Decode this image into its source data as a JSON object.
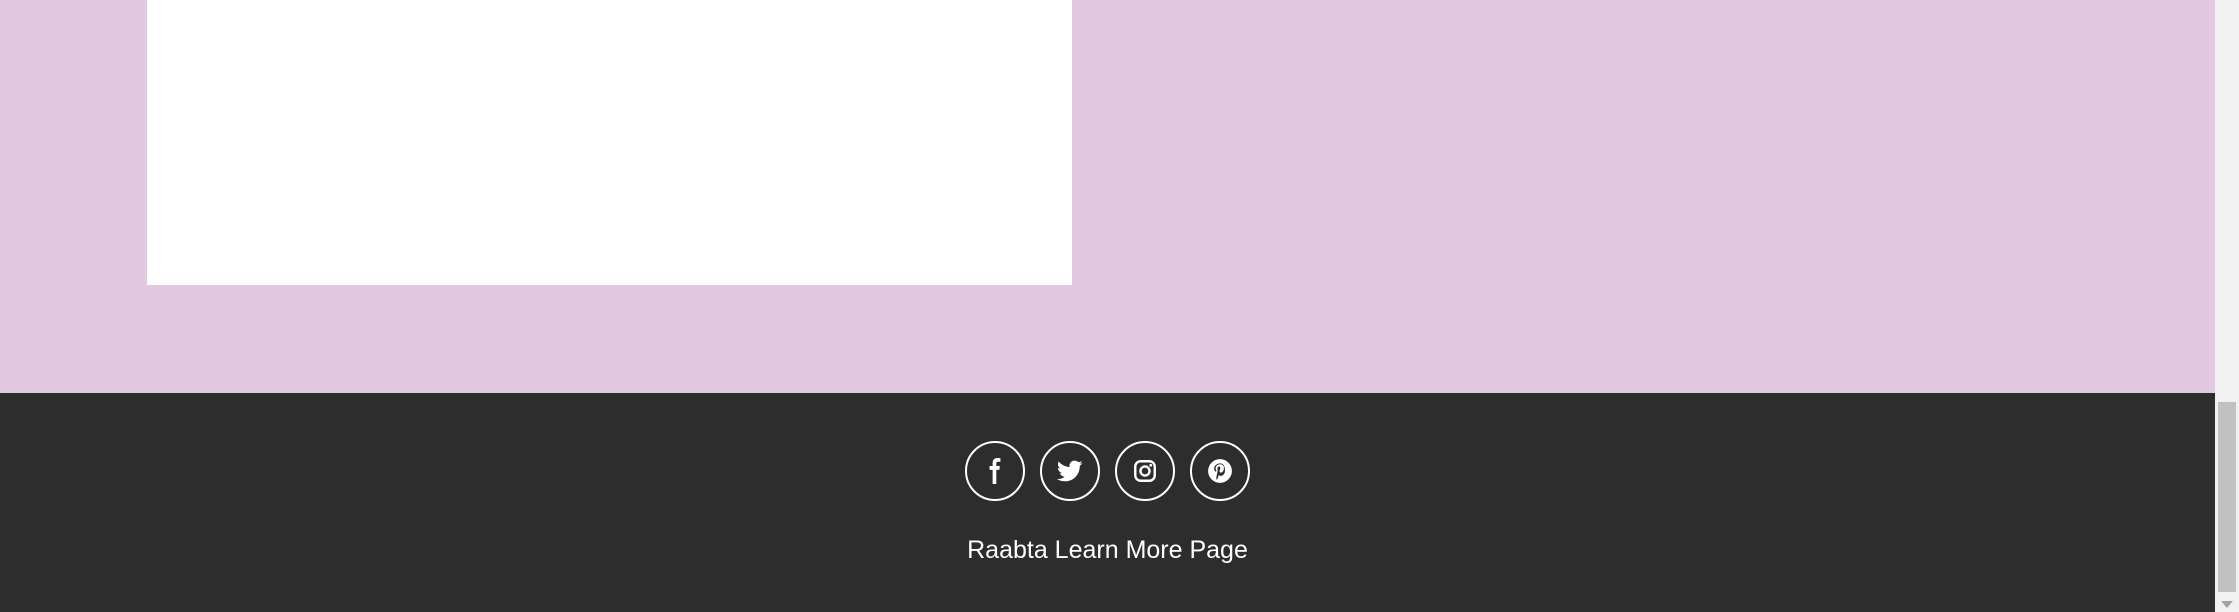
{
  "footer": {
    "title": "Raabta Learn More Page",
    "social": [
      {
        "icon": "facebook-icon",
        "network": "facebook"
      },
      {
        "icon": "twitter-icon",
        "network": "twitter"
      },
      {
        "icon": "instagram-icon",
        "network": "instagram"
      },
      {
        "icon": "pinterest-icon",
        "network": "pinterest"
      }
    ]
  },
  "colors": {
    "section_bg": "#e2c9df",
    "card_bg": "#ffffff",
    "footer_bg": "#2d2d2d",
    "footer_text": "#ffffff"
  }
}
